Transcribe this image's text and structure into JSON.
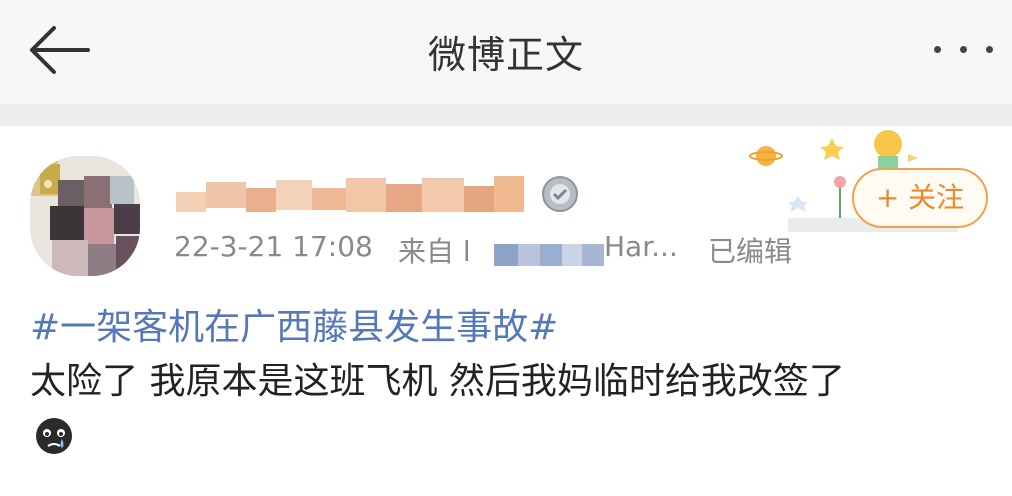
{
  "header": {
    "title": "微博正文",
    "back_icon": "back-arrow-icon",
    "more_icon": "more-dots-icon"
  },
  "post": {
    "meta": {
      "date": "22-3-21 17:08",
      "from": "来自",
      "source_prefix": "l",
      "source_suffix": "Har...",
      "edited": "已编辑"
    },
    "follow_label": "+ 关注",
    "hashtag": "#一架客机在广西藤县发生事故#",
    "text": "太险了 我原本是这班飞机 然后我妈临时给我改签了",
    "emoji_icon": "crying-face-icon",
    "badge_icon": "medal-icon"
  },
  "colors": {
    "link": "#5579b8",
    "follow": "#e8892c",
    "meta": "#8a8a8a",
    "text": "#222222",
    "header_bg": "#f7f7f7"
  }
}
